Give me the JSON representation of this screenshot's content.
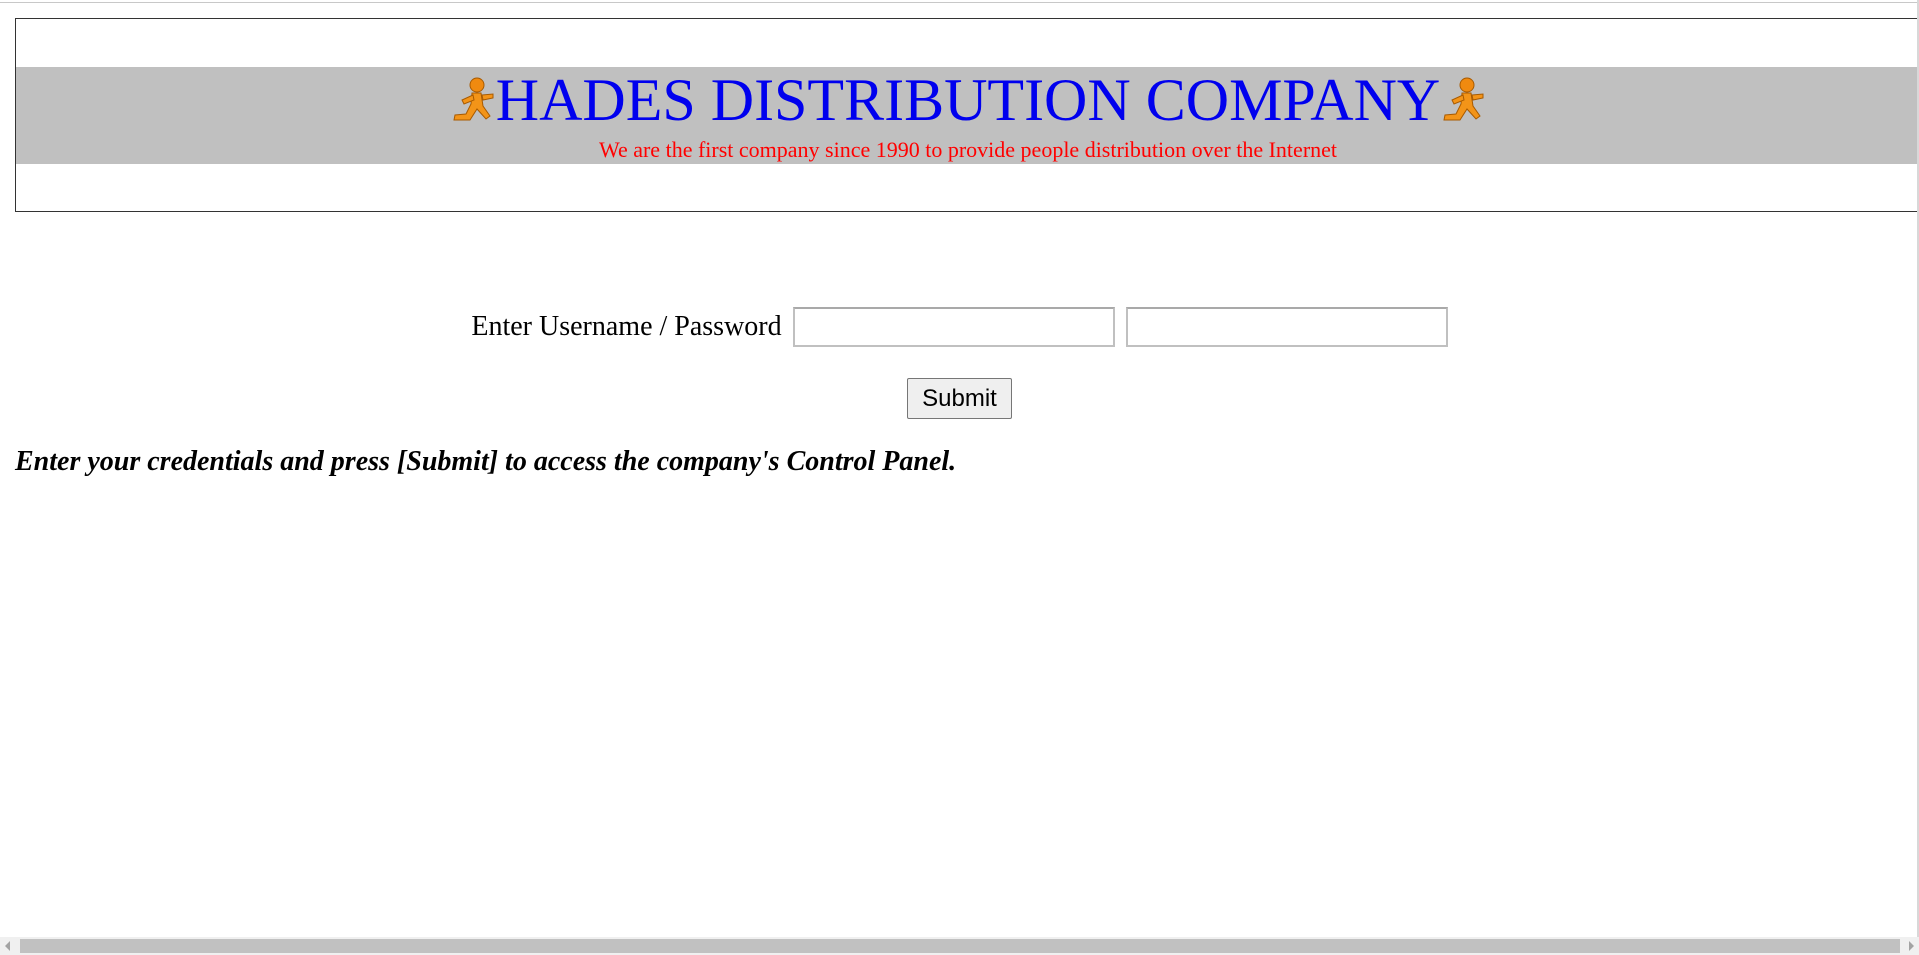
{
  "header": {
    "title": "HADES DISTRIBUTION COMPANY",
    "subtitle": "We are the first company since 1990 to provide people distribution over the Internet",
    "logo_icon": "running-man-icon",
    "colors": {
      "title": "#0000ee",
      "subtitle": "#ff0000",
      "band": "#c0c0c0"
    }
  },
  "login": {
    "label": "Enter Username / Password",
    "username_value": "",
    "password_value": "",
    "submit_label": "Submit"
  },
  "instructions": "Enter your credentials and press [Submit] to access the company's Control Panel."
}
